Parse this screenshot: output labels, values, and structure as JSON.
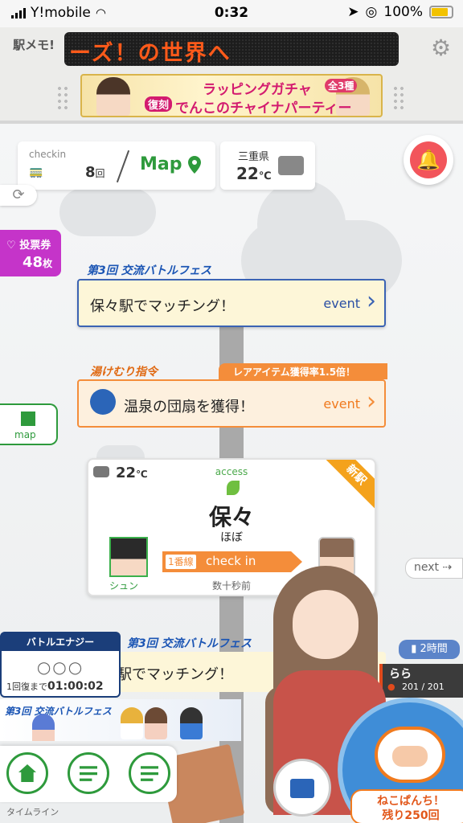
{
  "status_bar": {
    "carrier": "Y!mobile",
    "time": "0:32",
    "battery": "100%"
  },
  "header": {
    "logo": "駅メモ!",
    "marquee": "ーズ！の世界へ",
    "banner": {
      "line1": "ラッピングガチャ",
      "badge": "全3種",
      "tag": "復刻",
      "line2": "でんこのチャイナパーティー"
    }
  },
  "checkin": {
    "label": "checkin",
    "count": "8",
    "unit": "回",
    "map_label": "Map"
  },
  "weather": {
    "prefecture": "三重県",
    "temperature": "22",
    "unit": "℃"
  },
  "vote": {
    "label": "投票券",
    "count": "48",
    "unit": "枚"
  },
  "events": [
    {
      "header": "第3回 交流バトルフェス",
      "text": "保々駅でマッチング！",
      "link": "event"
    },
    {
      "header": "湯けむり指令",
      "badge": "レアアイテム獲得率1.5倍！",
      "text": "温泉の団扇を獲得！",
      "link": "event"
    }
  ],
  "map_button": "map",
  "station": {
    "temperature": "22",
    "unit": "℃",
    "access_label": "access",
    "name": "保々",
    "kana": "ほぼ",
    "new_badge": "新駅",
    "character_name": "シュン",
    "line_tag": "1番線",
    "checkin_label": "check in",
    "time_ago": "数十秒前"
  },
  "next_label": "next",
  "battle_energy": {
    "title": "バトルエナジー",
    "circles": "○○○",
    "recover_label": "1回復まで",
    "recover_time": "01:00:02"
  },
  "event3": {
    "header": "第3回 交流バトルフェス",
    "text": "駅でマッチング！"
  },
  "timeline_strip": {
    "header": "第3回 交流バトルフェス"
  },
  "hours_badge": "2時間",
  "denko": {
    "name": "らら",
    "hp": "201 / 201"
  },
  "nav": {
    "timeline_label": "タイムライン"
  },
  "punch": {
    "line1": "ねこぱんち！",
    "line2": "残り250回"
  },
  "colors": {
    "accent_green": "#2e9a3c",
    "event_blue": "#3b63b4",
    "event_orange": "#f48d3a",
    "vote_purple": "#c534c9",
    "bell_red": "#f2555b"
  }
}
